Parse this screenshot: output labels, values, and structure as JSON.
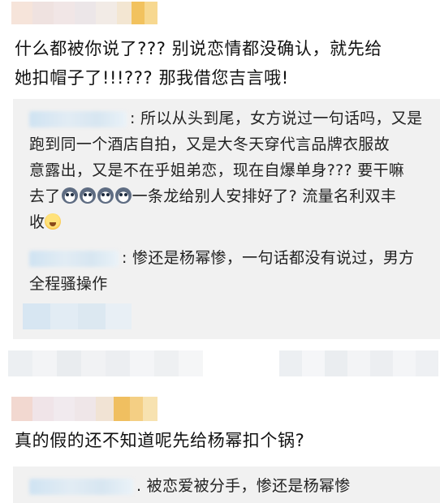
{
  "comments": [
    {
      "text_line1": "什么都被你说了??? 别说恋情都没确认，就先给",
      "text_line2": "她扣帽子了!!!??? 那我借您吉言哦!",
      "replies": [
        {
          "line1": ": 所以从头到尾，女方说过一句话吗，又是",
          "line2": "跑到同一个酒店自拍，又是大冬天穿代言品牌衣服故",
          "line3": "意露出，又是不在乎姐弟恋，现在自爆单身??? 要干嘛",
          "line4_pre": "去了",
          "line4_post": "一条龙给别人安排好了? 流量名利双丰",
          "line5": "收",
          "emoji_sequence": [
            "scared-face",
            "scared-face",
            "scared-face",
            "scared-face"
          ],
          "emoji_end": "flushed-face"
        },
        {
          "line1": ": 惨还是杨幂惨，一句话都没有说过，男方",
          "line2": "全程骚操作"
        }
      ]
    },
    {
      "text_line1": "真的假的还不知道呢先给杨幂扣个锅?",
      "replies": [
        {
          "line1": ". 被恋爱被分手，惨还是杨幂惨"
        }
      ]
    }
  ]
}
